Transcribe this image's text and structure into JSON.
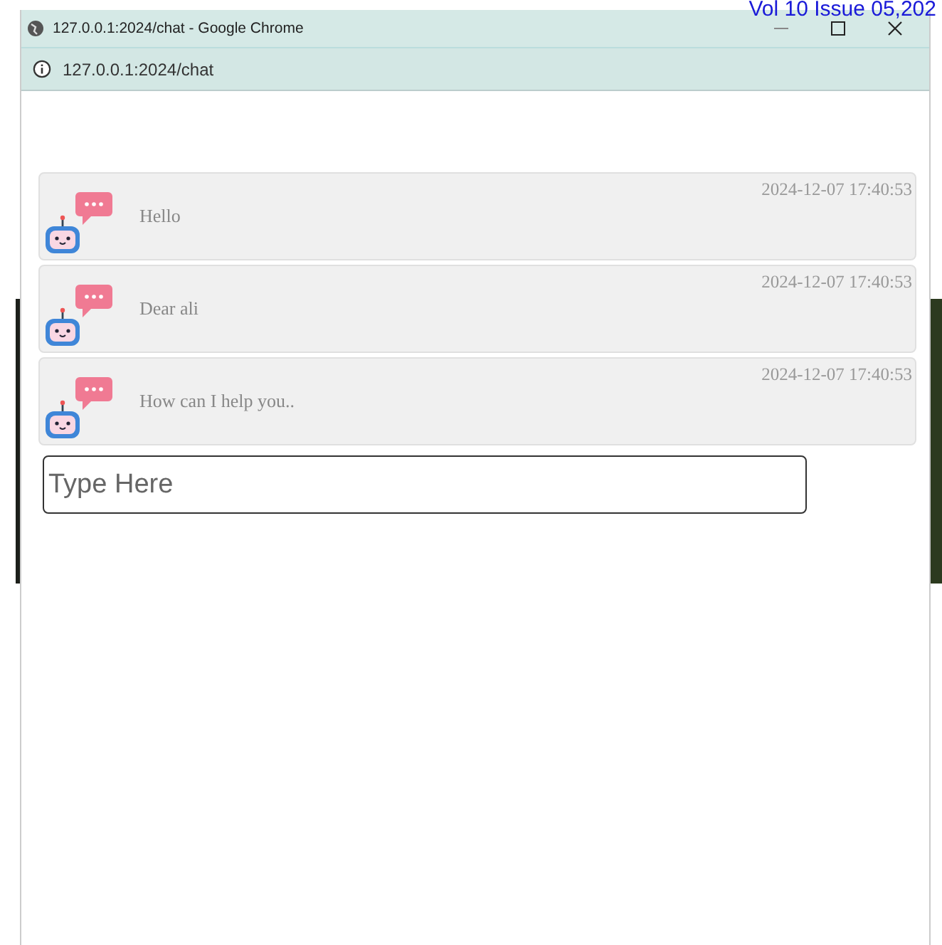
{
  "page_header": "Vol 10 Issue 05,202",
  "window": {
    "title": "127.0.0.1:2024/chat - Google Chrome",
    "address": "127.0.0.1:2024/chat"
  },
  "messages": [
    {
      "text": "Hello",
      "time": "2024-12-07 17:40:53"
    },
    {
      "text": "Dear ali",
      "time": "2024-12-07 17:40:53"
    },
    {
      "text": "How can I help you..",
      "time": "2024-12-07 17:40:53"
    }
  ],
  "input": {
    "placeholder": "Type Here"
  }
}
